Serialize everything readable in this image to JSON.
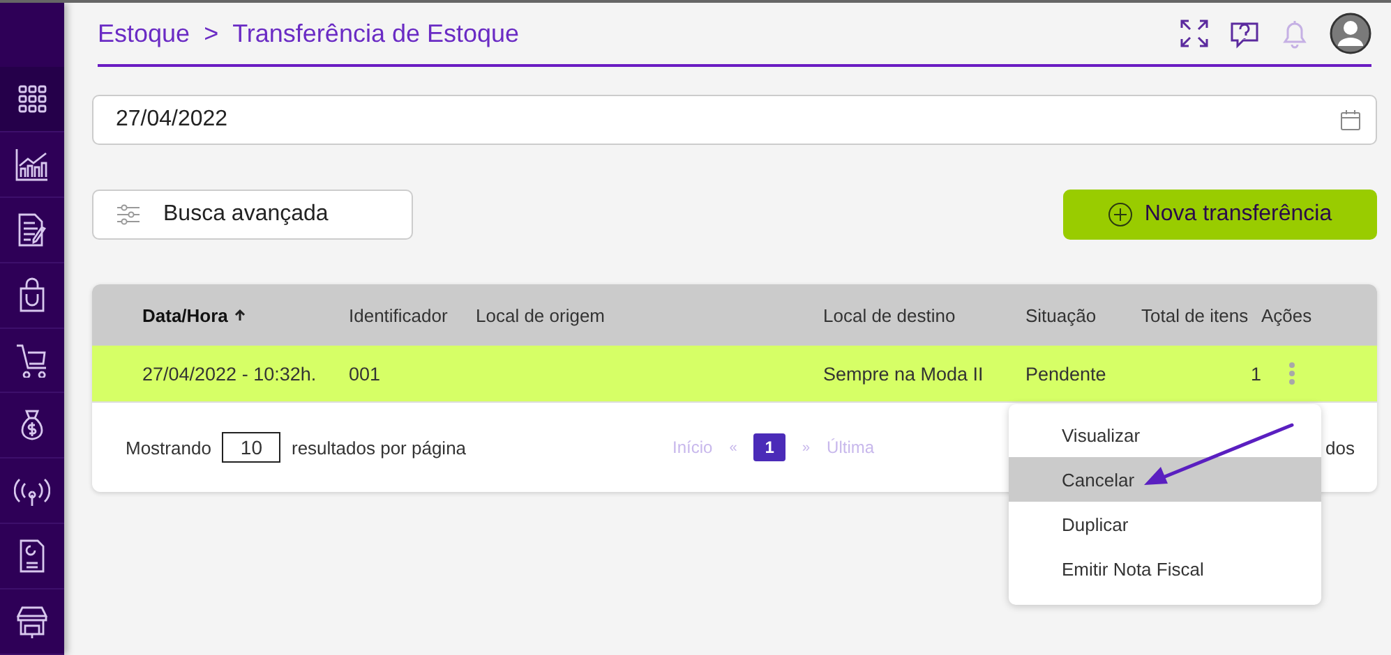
{
  "sidebar": {
    "items": [
      {
        "selected": true
      },
      {
        "selected": false
      },
      {
        "selected": false
      },
      {
        "selected": false
      },
      {
        "selected": false
      },
      {
        "selected": false
      },
      {
        "selected": false
      },
      {
        "selected": false
      },
      {
        "selected": false
      }
    ]
  },
  "breadcrumb": {
    "items": [
      "Estoque",
      "Transferência de Estoque"
    ],
    "separator": ">"
  },
  "date_field": {
    "value": "27/04/2022"
  },
  "advanced_search_button": "Busca avançada",
  "new_button": "Nova transferência",
  "table": {
    "columns": [
      {
        "label": "Data/Hora",
        "sorted": true
      },
      {
        "label": "Identificador",
        "sorted": false
      },
      {
        "label": "Local de origem",
        "sorted": false
      },
      {
        "label": "Local de destino",
        "sorted": false
      },
      {
        "label": "Situação",
        "sorted": false
      },
      {
        "label": "Total de itens",
        "sorted": false
      },
      {
        "label": "Ações",
        "sorted": false
      }
    ],
    "rows": [
      {
        "cells": [
          "27/04/2022 - 10:32h.",
          "001",
          "",
          "Sempre na Moda II",
          "Pendente",
          "1"
        ],
        "highlighted": true
      }
    ]
  },
  "footer": {
    "showing_label": "Mostrando",
    "page_size": "10",
    "per_page_label": "resultados por página",
    "first": "Início",
    "prev": "«",
    "pages": [
      {
        "label": "1",
        "selected": true
      }
    ],
    "next": "»",
    "last": "Última",
    "summary": "dos"
  },
  "actions_menu": {
    "items": [
      {
        "label": "Visualizar",
        "selected": false
      },
      {
        "label": "Cancelar",
        "selected": true
      },
      {
        "label": "Duplicar",
        "selected": false
      },
      {
        "label": "Emitir Nota Fiscal",
        "selected": false
      }
    ]
  }
}
